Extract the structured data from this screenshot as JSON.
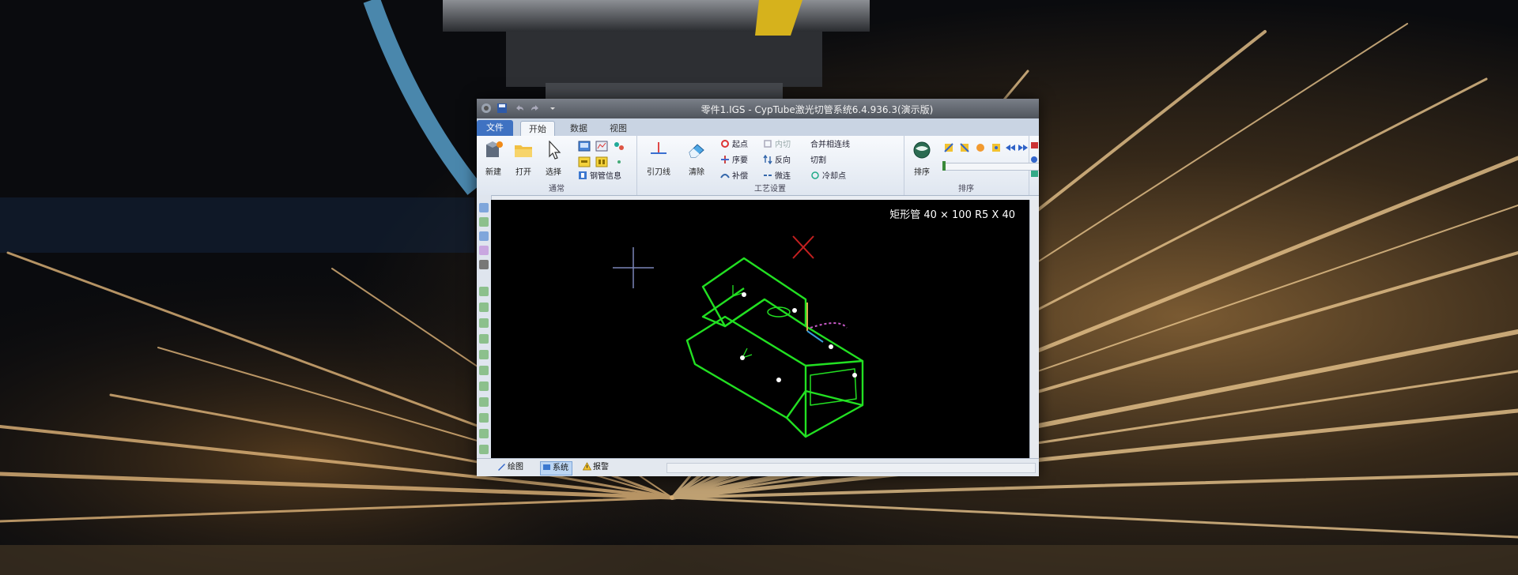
{
  "window": {
    "title": "零件1.IGS - CypTube激光切管系统6.4.936.3(演示版)"
  },
  "tabs": [
    {
      "id": "file",
      "label": "文件"
    },
    {
      "id": "start",
      "label": "开始"
    },
    {
      "id": "data",
      "label": "数据"
    },
    {
      "id": "view",
      "label": "视图"
    }
  ],
  "ribbon": {
    "groups": {
      "browse": {
        "label": "通常"
      },
      "process": {
        "label": "工艺设置"
      },
      "sort": {
        "label": "排序"
      }
    },
    "buttons": {
      "new": "新建",
      "open": "打开",
      "select": "选择",
      "pipe_info": "钢管信息",
      "lead_line": "引刀线",
      "clear": "清除",
      "start_point": "起点",
      "inner": "内切",
      "order": "序要",
      "reverse": "反向",
      "compensate": "补偿",
      "micro_joint": "微连",
      "merge_common": "合并相连线",
      "cut": "切割",
      "cool_point": "冷却点",
      "sort_btn": "排序"
    }
  },
  "canvas": {
    "label": "矩形管 40 × 100 R5 X 40"
  },
  "bottom_tabs": [
    {
      "id": "drawing",
      "label": "绘图"
    },
    {
      "id": "system",
      "label": "系统"
    },
    {
      "id": "alarm",
      "label": "报警"
    }
  ],
  "colors": {
    "part_outline": "#22e022",
    "canvas_bg": "#000000",
    "ribbon_accent": "#3f72c2"
  }
}
